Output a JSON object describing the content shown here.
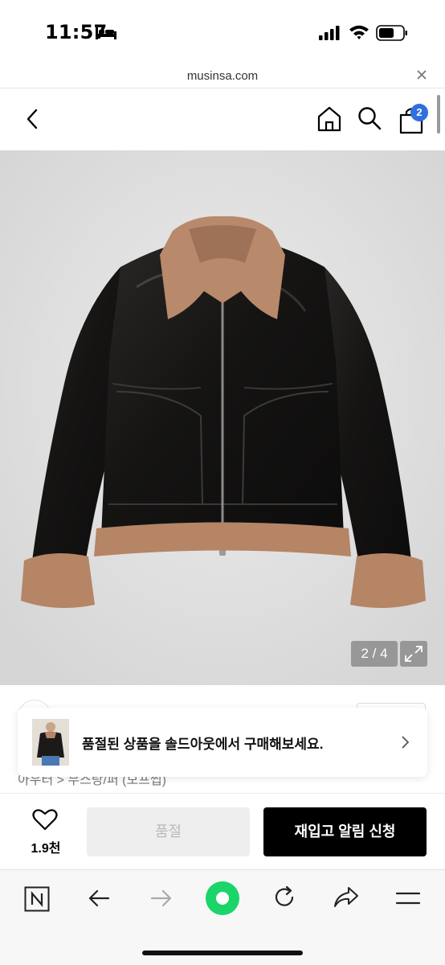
{
  "status_bar": {
    "time": "11:57"
  },
  "url_bar": {
    "url": "musinsa.com"
  },
  "header": {
    "cart_count": "2"
  },
  "gallery": {
    "page_indicator": "2 / 4",
    "current_page": 2,
    "total_pages": 4
  },
  "product": {
    "breadcrumb": "아우터 > 무스탕/퍼 (모프썹)"
  },
  "toast": {
    "message": "품절된 상품을 솔드아웃에서 구매해보세요."
  },
  "purchase_bar": {
    "like_count": "1.9천",
    "soldout_label": "품절",
    "restock_label": "재입고 알림 신청"
  },
  "colors": {
    "cart_badge": "#2f6fe0",
    "restock_button": "#000000",
    "browser_green": "#1bd46a",
    "image_background": "#dcdcdc"
  },
  "icons": {
    "status": [
      "bed-icon",
      "signal-icon",
      "wifi-icon",
      "battery-icon"
    ],
    "header": [
      "back-arrow-icon",
      "home-icon",
      "search-icon",
      "cart-icon"
    ],
    "browser": [
      "naver-n-icon",
      "back-arrow-icon",
      "forward-arrow-icon",
      "green-circle-icon",
      "reload-icon",
      "share-icon",
      "menu-icon"
    ]
  }
}
